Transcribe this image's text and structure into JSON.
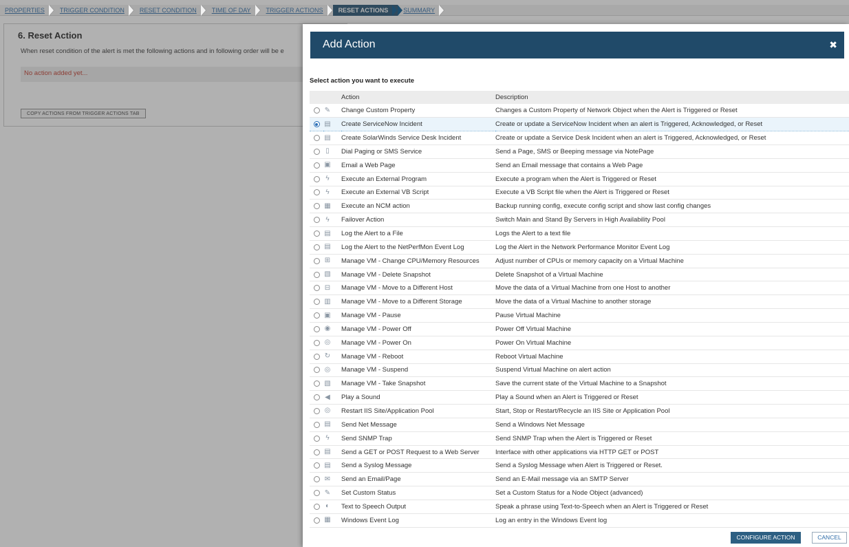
{
  "wizard": {
    "steps": [
      {
        "label": "PROPERTIES",
        "active": false
      },
      {
        "label": "TRIGGER CONDITION",
        "active": false
      },
      {
        "label": "RESET CONDITION",
        "active": false
      },
      {
        "label": "TIME OF DAY",
        "active": false
      },
      {
        "label": "TRIGGER ACTIONS",
        "active": false
      },
      {
        "label": "RESET ACTIONS",
        "active": true
      },
      {
        "label": "SUMMARY",
        "active": false
      }
    ]
  },
  "page": {
    "title": "6. Reset Action",
    "description": "When reset condition of the alert is met the following actions and in following order will be e",
    "empty_message": "No action added yet...",
    "copy_button": "COPY ACTIONS FROM TRIGGER ACTIONS TAB"
  },
  "dialog": {
    "title": "Add Action",
    "close_glyph": "✖",
    "subtitle": "Select action you want to execute",
    "columns": {
      "action": "Action",
      "description": "Description"
    },
    "rows": [
      {
        "icon": "pencil-icon",
        "glyph": "✎",
        "action": "Change Custom Property",
        "description": "Changes a Custom Property of Network Object when the Alert is Triggered or Reset",
        "selected": false
      },
      {
        "icon": "servicenow-icon",
        "glyph": "▤",
        "action": "Create ServiceNow Incident",
        "description": "Create or update a ServiceNow Incident when an alert is Triggered, Acknowledged, or Reset",
        "selected": true
      },
      {
        "icon": "service-desk-icon",
        "glyph": "▤",
        "action": "Create SolarWinds Service Desk Incident",
        "description": "Create or update a Service Desk Incident when an alert is Triggered, Acknowledged, or Reset",
        "selected": false
      },
      {
        "icon": "pager-icon",
        "glyph": "▯",
        "action": "Dial Paging or SMS Service",
        "description": "Send a Page, SMS or Beeping message via NotePage",
        "selected": false
      },
      {
        "icon": "web-page-icon",
        "glyph": "▣",
        "action": "Email a Web Page",
        "description": "Send an Email message that contains a Web Page",
        "selected": false
      },
      {
        "icon": "lightning-icon",
        "glyph": "ϟ",
        "action": "Execute an External Program",
        "description": "Execute a program when the Alert is Triggered or Reset",
        "selected": false
      },
      {
        "icon": "lightning-icon",
        "glyph": "ϟ",
        "action": "Execute an External VB Script",
        "description": "Execute a VB Script file when the Alert is Triggered or Reset",
        "selected": false
      },
      {
        "icon": "ncm-icon",
        "glyph": "▦",
        "action": "Execute an NCM action",
        "description": "Backup running config, execute config script and show last config changes",
        "selected": false
      },
      {
        "icon": "lightning-icon",
        "glyph": "ϟ",
        "action": "Failover Action",
        "description": "Switch Main and Stand By Servers in High Availability Pool",
        "selected": false
      },
      {
        "icon": "log-file-icon",
        "glyph": "▤",
        "action": "Log the Alert to a File",
        "description": "Logs the Alert to a text file",
        "selected": false
      },
      {
        "icon": "log-file-icon",
        "glyph": "▤",
        "action": "Log the Alert to the NetPerfMon Event Log",
        "description": "Log the Alert in the Network Performance Monitor Event Log",
        "selected": false
      },
      {
        "icon": "vm-resources-icon",
        "glyph": "⊞",
        "action": "Manage VM - Change CPU/Memory Resources",
        "description": "Adjust number of CPUs or memory capacity on a Virtual Machine",
        "selected": false
      },
      {
        "icon": "vm-snapshot-icon",
        "glyph": "▧",
        "action": "Manage VM - Delete Snapshot",
        "description": "Delete Snapshot of a Virtual Machine",
        "selected": false
      },
      {
        "icon": "vm-host-icon",
        "glyph": "⊟",
        "action": "Manage VM - Move to a Different Host",
        "description": "Move the data of a Virtual Machine from one Host to another",
        "selected": false
      },
      {
        "icon": "vm-storage-icon",
        "glyph": "▥",
        "action": "Manage VM - Move to a Different Storage",
        "description": "Move the data of a Virtual Machine to another storage",
        "selected": false
      },
      {
        "icon": "pause-icon",
        "glyph": "▣",
        "action": "Manage VM - Pause",
        "description": "Pause Virtual Machine",
        "selected": false
      },
      {
        "icon": "power-off-icon",
        "glyph": "◉",
        "action": "Manage VM - Power Off",
        "description": "Power Off Virtual Machine",
        "selected": false
      },
      {
        "icon": "power-on-icon",
        "glyph": "◎",
        "action": "Manage VM - Power On",
        "description": "Power On Virtual Machine",
        "selected": false
      },
      {
        "icon": "reboot-icon",
        "glyph": "↻",
        "action": "Manage VM - Reboot",
        "description": "Reboot Virtual Machine",
        "selected": false
      },
      {
        "icon": "suspend-icon",
        "glyph": "◎",
        "action": "Manage VM - Suspend",
        "description": "Suspend Virtual Machine on alert action",
        "selected": false
      },
      {
        "icon": "take-snapshot-icon",
        "glyph": "▧",
        "action": "Manage VM - Take Snapshot",
        "description": "Save the current state of the Virtual Machine to a Snapshot",
        "selected": false
      },
      {
        "icon": "sound-icon",
        "glyph": "◀",
        "action": "Play a Sound",
        "description": "Play a Sound when an Alert is Triggered or Reset",
        "selected": false
      },
      {
        "icon": "iis-icon",
        "glyph": "◎",
        "action": "Restart IIS Site/Application Pool",
        "description": "Start, Stop or Restart/Recycle an IIS Site or Application Pool",
        "selected": false
      },
      {
        "icon": "net-message-icon",
        "glyph": "▤",
        "action": "Send Net Message",
        "description": "Send a Windows Net Message",
        "selected": false
      },
      {
        "icon": "lightning-icon",
        "glyph": "ϟ",
        "action": "Send SNMP Trap",
        "description": "Send SNMP Trap when the Alert is Triggered or Reset",
        "selected": false
      },
      {
        "icon": "http-request-icon",
        "glyph": "▤",
        "action": "Send a GET or POST Request to a Web Server",
        "description": "Interface with other applications via HTTP GET or POST",
        "selected": false
      },
      {
        "icon": "syslog-icon",
        "glyph": "▤",
        "action": "Send a Syslog Message",
        "description": "Send a Syslog Message when Alert is Triggered or Reset.",
        "selected": false
      },
      {
        "icon": "envelope-icon",
        "glyph": "✉",
        "action": "Send an Email/Page",
        "description": "Send an E-Mail message via an SMTP Server",
        "selected": false
      },
      {
        "icon": "pencil-icon",
        "glyph": "✎",
        "action": "Set Custom Status",
        "description": "Set a Custom Status for a Node Object (advanced)",
        "selected": false
      },
      {
        "icon": "speech-icon",
        "glyph": "◐",
        "action": "Text to Speech Output",
        "description": "Speak a phrase using Text-to-Speech when an Alert is Triggered or Reset",
        "selected": false
      },
      {
        "icon": "event-log-icon",
        "glyph": "▦",
        "action": "Windows Event Log",
        "description": "Log an entry in the Windows Event log",
        "selected": false
      }
    ],
    "configure_button": "CONFIGURE ACTION",
    "cancel_button": "CANCEL"
  }
}
